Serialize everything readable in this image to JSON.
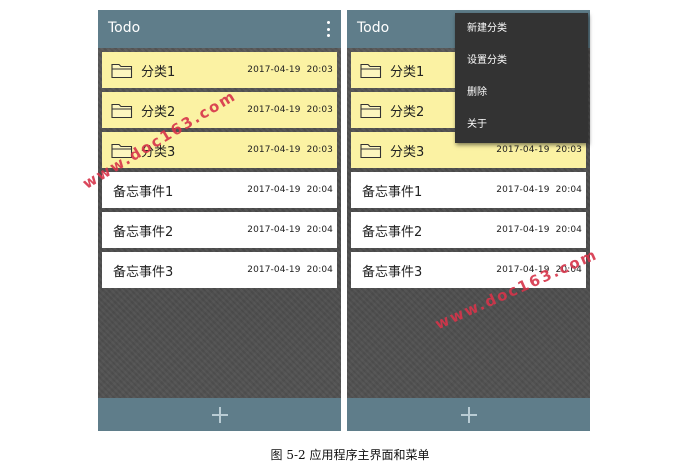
{
  "screens": [
    {
      "app_title": "Todo",
      "add_icon": "plus-icon",
      "overflow_icon": "more-vert-icon",
      "items": [
        {
          "type": "folder",
          "label": "分类1",
          "date": "2017-04-19",
          "time": "20:03"
        },
        {
          "type": "folder",
          "label": "分类2",
          "date": "2017-04-19",
          "time": "20:03"
        },
        {
          "type": "folder",
          "label": "分类3",
          "date": "2017-04-19",
          "time": "20:03"
        },
        {
          "type": "memo",
          "label": "备忘事件1",
          "date": "2017-04-19",
          "time": "20:04"
        },
        {
          "type": "memo",
          "label": "备忘事件2",
          "date": "2017-04-19",
          "time": "20:04"
        },
        {
          "type": "memo",
          "label": "备忘事件3",
          "date": "2017-04-19",
          "time": "20:04"
        }
      ]
    },
    {
      "app_title": "Todo",
      "add_icon": "plus-icon",
      "items": [
        {
          "type": "folder",
          "label": "分类1",
          "date": "",
          "time": ""
        },
        {
          "type": "folder",
          "label": "分类2",
          "date": "",
          "time": ""
        },
        {
          "type": "folder",
          "label": "分类3",
          "date": "2017-04-19",
          "time": "20:03"
        },
        {
          "type": "memo",
          "label": "备忘事件1",
          "date": "2017-04-19",
          "time": "20:04"
        },
        {
          "type": "memo",
          "label": "备忘事件2",
          "date": "2017-04-19",
          "time": "20:04"
        },
        {
          "type": "memo",
          "label": "备忘事件3",
          "date": "2017-04-19",
          "time": "20:04"
        }
      ],
      "menu": [
        "新建分类",
        "设置分类",
        "删除",
        "关于"
      ]
    }
  ],
  "watermarks": [
    "www.doc163.com",
    "www.doc163.com"
  ],
  "caption": "图 5-2  应用程序主界面和菜单",
  "colors": {
    "appbar": "#5f7d8a",
    "folder_row": "#fbf2a3",
    "memo_row": "#ffffff",
    "menu_bg": "#333333",
    "watermark": "#d7344a"
  }
}
